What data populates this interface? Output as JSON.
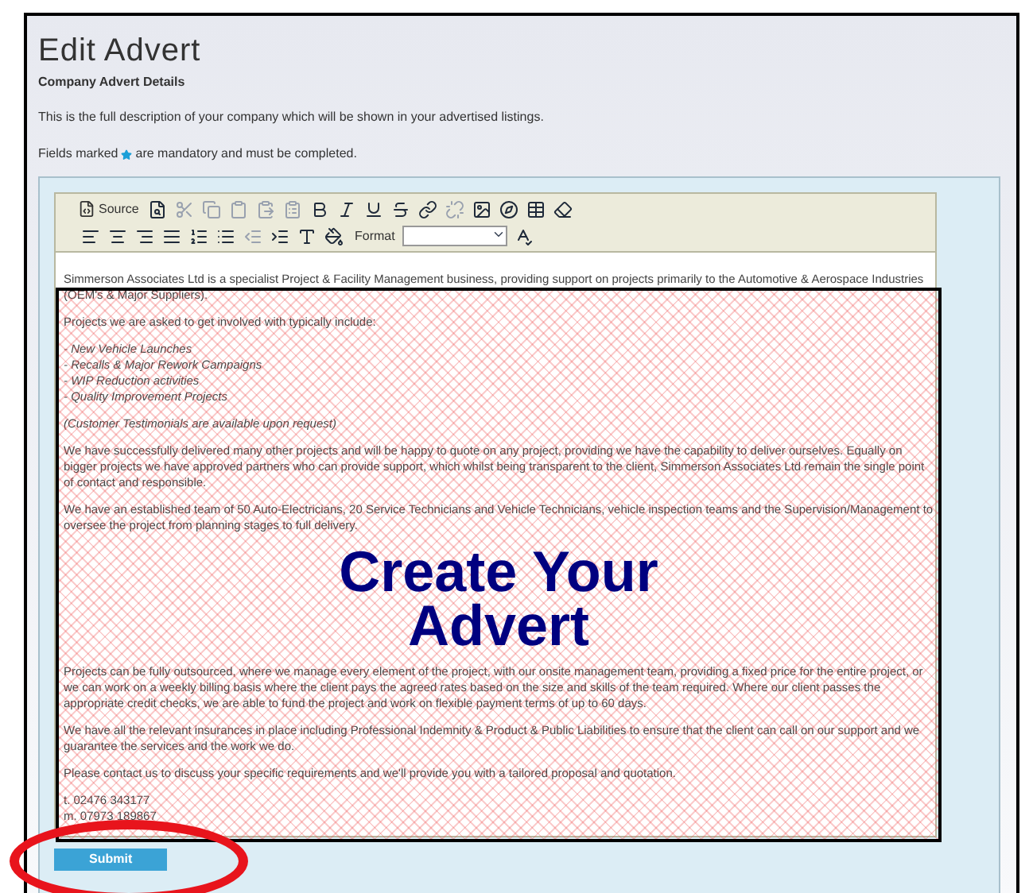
{
  "page": {
    "title": "Edit Advert",
    "subtitle": "Company Advert Details",
    "description": "This is the full description of your company which will be shown in your advertised listings.",
    "mandatory_before": "Fields marked",
    "mandatory_after": "are mandatory and must be completed."
  },
  "toolbar": {
    "source_label": "Source",
    "format_label": "Format",
    "row_1": [
      {
        "disabled": false
      },
      {
        "disabled": true
      },
      {
        "disabled": true
      },
      {
        "disabled": true
      },
      {
        "disabled": true
      },
      {
        "disabled": true
      },
      {
        "disabled": false
      },
      {
        "disabled": false
      },
      {
        "disabled": false
      },
      {
        "disabled": false
      },
      {
        "disabled": false
      },
      {
        "disabled": true
      },
      {
        "disabled": false
      },
      {
        "disabled": false
      },
      {
        "disabled": false
      },
      {
        "disabled": false
      }
    ],
    "row_2": [
      {
        "disabled": false
      },
      {
        "disabled": false
      },
      {
        "disabled": false
      },
      {
        "disabled": false
      },
      {
        "disabled": false
      },
      {
        "disabled": false
      },
      {
        "disabled": true
      },
      {
        "disabled": false
      },
      {
        "disabled": false
      },
      {
        "disabled": false
      },
      {
        "disabled": false
      }
    ]
  },
  "content": [
    {
      "kind": "text",
      "text": "Simmerson Associates Ltd is a specialist Project & Facility Management business, providing support on projects primarily to the Automotive & Aerospace Industries (OEM's & Major Suppliers)."
    },
    {
      "kind": "text",
      "text": "Projects we are asked to get involved with typically include:"
    },
    {
      "kind": "list",
      "items": [
        "- New Vehicle Launches",
        "- Recalls & Major Rework Campaigns",
        "- WIP Reduction activities",
        "- Quality Improvement Projects"
      ]
    },
    {
      "kind": "italic",
      "text": "(Customer Testimonials are available upon request)"
    },
    {
      "kind": "text",
      "text": "We have successfully delivered many other projects and will be happy to quote on any project, providing we have the capability to deliver ourselves. Equally on bigger projects we have approved partners who can provide support, which whilst being transparent to the client, Simmerson Associates Ltd remain the single point of contact and responsible."
    },
    {
      "kind": "text",
      "text": "We have an established team of 50 Auto-Electricians, 20 Service Technicians and Vehicle Technicians, vehicle inspection teams and the Supervision/Management to oversee the project from planning stages to full delivery."
    },
    {
      "kind": "text",
      "text": "Projects can be fully outsourced, where we manage every element of the project, with our onsite management team, providing a fixed price for the entire project, or we can work on a weekly billing basis where the client pays the agreed rates based on the size and skills of the team required. Where our client passes the appropriate credit checks, we are able to fund the project and work on flexible payment terms of up to 60 days."
    },
    {
      "kind": "text",
      "text": "We have all the relevant insurances in place including Professional Indemnity & Product & Public Liabilities to ensure that the client can call on our support and we guarantee the services and the work we do."
    },
    {
      "kind": "text",
      "text": "Please contact us to discuss your specific requirements and we'll provide you with a tailored proposal and quotation."
    },
    {
      "kind": "list",
      "items": [
        "t.   02476 343177",
        "m. 07973 189867"
      ]
    }
  ],
  "overlay": {
    "lines": [
      "Create Your",
      "Advert"
    ]
  },
  "submit": {
    "label": "Submit"
  }
}
